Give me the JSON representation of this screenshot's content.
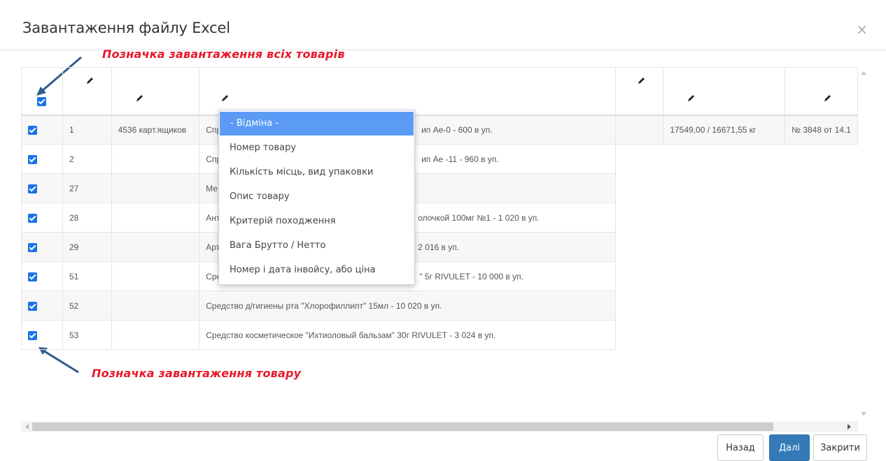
{
  "modal": {
    "title": "Завантаження файлу Excel",
    "close_symbol": "×"
  },
  "annotations": {
    "select_all": "Позначка завантаження  всіх товарів",
    "select_row": "Позначка завантаження товару"
  },
  "table": {
    "rows": [
      {
        "c1": "1",
        "c2": "4536 карт.ящиков",
        "c3_prefix": "Спр",
        "c3_suffix": "ип Ае-0 - 600 в уп.",
        "c4": "",
        "c5": "17549,00 / 16671,55 кг",
        "c6": "№ 3848 от 14.1"
      },
      {
        "c1": "2",
        "c2": "",
        "c3_prefix": "Спр",
        "c3_suffix": "ип Ае -11 - 960 в уп."
      },
      {
        "c1": "27",
        "c2": "",
        "c3_prefix": "Ме",
        "c3_suffix": ""
      },
      {
        "c1": "28",
        "c2": "",
        "c3_prefix": "Ант",
        "c3_suffix": "олочкой 100мг №1 - 1 020 в уп."
      },
      {
        "c1": "29",
        "c2": "",
        "c3_prefix": "Арт",
        "c3_suffix": "2 016 в уп."
      },
      {
        "c1": "51",
        "c2": "",
        "c3_prefix": "Сре",
        "c3_suffix": "\" 5г RIVULET - 10 000 в уп."
      },
      {
        "c1": "52",
        "c2": "",
        "c3": "Средство д/гигиены рта \"Хлорофиллипт\" 15мл - 10 020 в уп."
      },
      {
        "c1": "53",
        "c2": "",
        "c3": "Средство косметическое \"Ихтиоловый бальзам\" 30г RIVULET - 3 024 в уп."
      }
    ]
  },
  "dropdown": {
    "options": [
      "- Відміна -",
      "Номер товару",
      "Кількість місць, вид упаковки",
      "Опис товару",
      "Критерій походження",
      "Вага Брутто / Нетто",
      "Номер і дата інвойсу, або ціна"
    ],
    "selected_index": 0
  },
  "buttons": {
    "back": "Назад",
    "next": "Далі",
    "close": "Закрити"
  },
  "colors": {
    "accent": "#1a73e8",
    "primary_button": "#337ab7",
    "annotation": "#e8182c",
    "dropdown_selected": "#5b9bf6"
  },
  "icons": {
    "column_edit": "pencil-icon"
  }
}
